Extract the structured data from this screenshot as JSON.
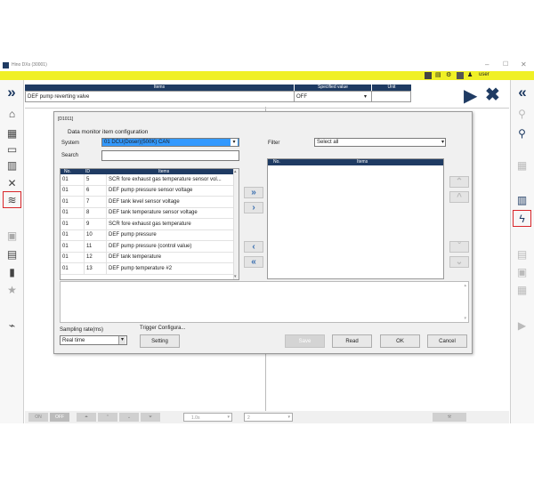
{
  "window": {
    "title": "Hino DXs (30001)",
    "user": "user"
  },
  "top_header": {
    "col_items": "Items",
    "col_specified": "Specified value",
    "col_unit": "Unit",
    "row_item": "DEF pump reverting valve",
    "row_value": "OFF",
    "row_unit": ""
  },
  "dialog": {
    "code": "[D1011]",
    "title": "Data monitor item configuration",
    "system_label": "System",
    "system_value": "01  DCU(Doser)(500K)  CAN",
    "search_label": "Search",
    "search_value": "",
    "filter_label": "Filter",
    "filter_value": "Select all",
    "left_cols": {
      "no": "No.",
      "id": "ID",
      "items": "Items"
    },
    "right_cols": {
      "no": "No.",
      "items": "Items"
    },
    "rows": [
      {
        "no": "01",
        "id": "5",
        "item": "SCR fore exhaust gas temperature sensor vol..."
      },
      {
        "no": "01",
        "id": "6",
        "item": "DEF pump pressure sensor voltage"
      },
      {
        "no": "01",
        "id": "7",
        "item": "DEF tank level sensor voltage"
      },
      {
        "no": "01",
        "id": "8",
        "item": "DEF tank temperature sensor voltage"
      },
      {
        "no": "01",
        "id": "9",
        "item": "SCR fore exhaust gas temperature"
      },
      {
        "no": "01",
        "id": "10",
        "item": "DEF pump pressure"
      },
      {
        "no": "01",
        "id": "11",
        "item": "DEF pump pressure (control value)"
      },
      {
        "no": "01",
        "id": "12",
        "item": "DEF tank temperature"
      },
      {
        "no": "01",
        "id": "13",
        "item": "DEF pump temperature #2"
      }
    ],
    "sampling_label": "Sampling rate(ms)",
    "sampling_value": "Real time",
    "trigger_label": "Trigger Configura...",
    "setting_btn": "Setting",
    "save_btn": "Save",
    "read_btn": "Read",
    "ok_btn": "OK",
    "cancel_btn": "Cancel"
  },
  "bottom_toolbar": {
    "on": "ON",
    "off": "OFF",
    "interval": "1.0s",
    "count": "2"
  },
  "colors": {
    "accent": "#1f3b63",
    "highlight": "#3399ff",
    "yellow": "#f0f026",
    "red_frame": "#d9262a"
  }
}
